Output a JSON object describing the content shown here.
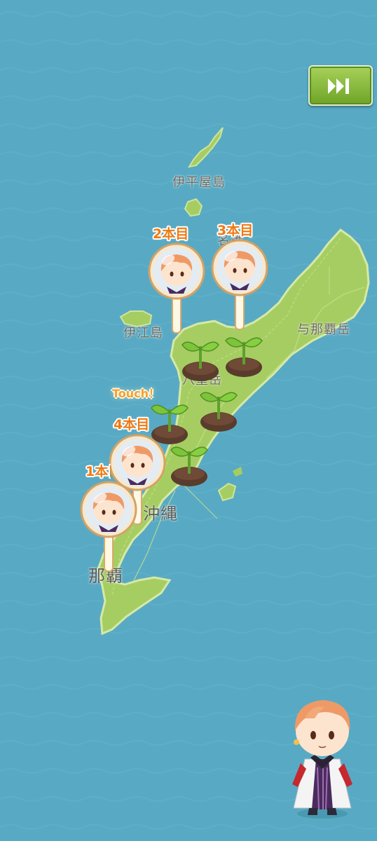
{
  "map": {
    "sea_color": "#58aac4",
    "land_color": "#a6cd62",
    "place_names": {
      "iheya": "伊平屋島",
      "nago": "名護",
      "ie": "伊江島",
      "yonaha": "与那覇岳",
      "yaedake": "八重岳",
      "okinawa": "沖縄",
      "naha": "那覇"
    }
  },
  "controls": {
    "skip_icon": "fast-forward-icon"
  },
  "pins": [
    {
      "label": "2本目",
      "icon": "character-magnifier-icon"
    },
    {
      "label": "3本目",
      "icon": "character-magnifier-icon"
    },
    {
      "label": "4本目",
      "icon": "character-magnifier-icon"
    },
    {
      "label": "1本目",
      "icon": "character-magnifier-icon"
    }
  ],
  "prompt": {
    "touch": "Touch！"
  },
  "sprouts": {
    "count": 5,
    "icon": "sprout-icon"
  },
  "mascot": {
    "icon": "chibi-character-icon"
  }
}
